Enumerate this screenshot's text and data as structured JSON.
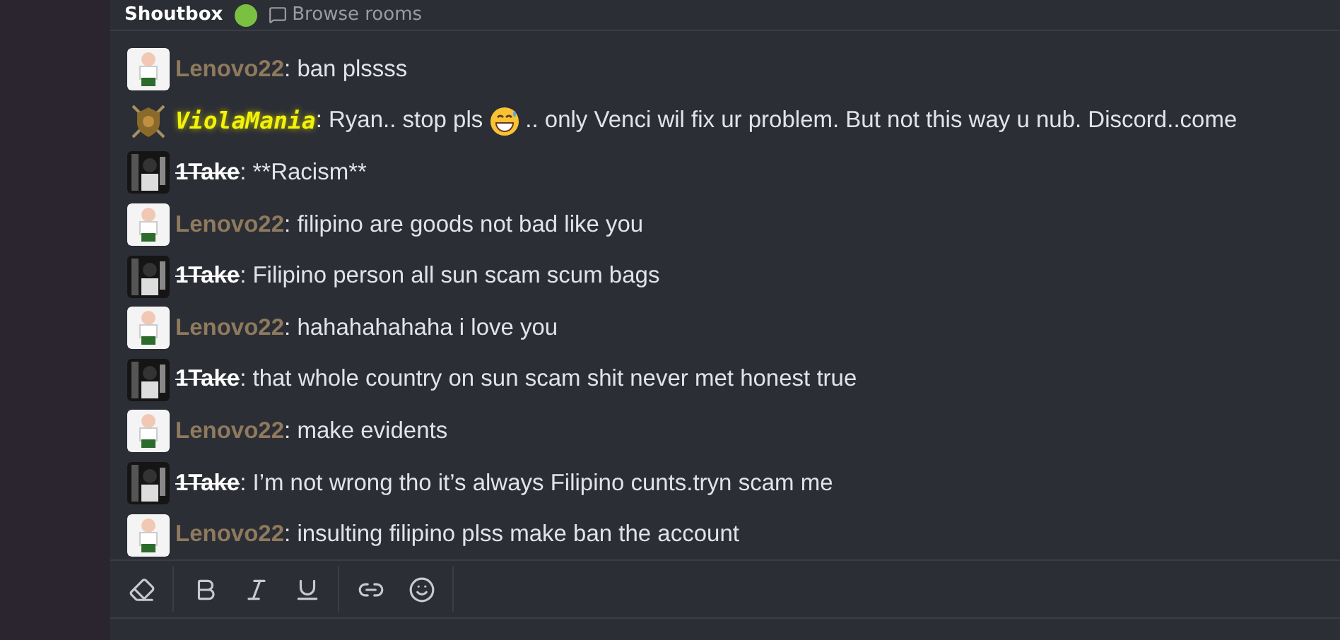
{
  "header": {
    "title": "Shoutbox",
    "link": "Browse rooms"
  },
  "messages": [
    {
      "user": "Lenovo22",
      "kind": "plain",
      "avatar": {
        "kind": "light"
      },
      "parts": [
        {
          "kind": "text",
          "text": ": ban plssss"
        }
      ]
    },
    {
      "user": "ViolaMania",
      "kind": "glow",
      "avatar": {
        "kind": "badge"
      },
      "parts": [
        {
          "kind": "text",
          "text": ": Ryan.. stop pls"
        },
        {
          "kind": "emoji"
        },
        {
          "kind": "text",
          "text": ".. only Venci wil fix ur problem. But not this way u nub. Discord..come"
        }
      ]
    },
    {
      "user": "1Take",
      "kind": "struck",
      "avatar": {
        "kind": "dark"
      },
      "parts": [
        {
          "kind": "text",
          "text": ": **Racism**"
        }
      ]
    },
    {
      "user": "Lenovo22",
      "kind": "plain",
      "avatar": {
        "kind": "light"
      },
      "parts": [
        {
          "kind": "text",
          "text": ": filipino are goods not bad like you"
        }
      ]
    },
    {
      "user": "1Take",
      "kind": "struck",
      "avatar": {
        "kind": "dark"
      },
      "parts": [
        {
          "kind": "text",
          "text": ": Filipino person all sun scam scum bags"
        }
      ]
    },
    {
      "user": "Lenovo22",
      "kind": "plain",
      "avatar": {
        "kind": "light"
      },
      "parts": [
        {
          "kind": "text",
          "text": ": hahahahahaha i love you"
        }
      ]
    },
    {
      "user": "1Take",
      "kind": "struck",
      "avatar": {
        "kind": "dark"
      },
      "parts": [
        {
          "kind": "text",
          "text": ": that whole country on sun scam shit never met honest true"
        }
      ]
    },
    {
      "user": "Lenovo22",
      "kind": "plain",
      "avatar": {
        "kind": "light"
      },
      "parts": [
        {
          "kind": "text",
          "text": ": make evidents"
        }
      ]
    },
    {
      "user": "1Take",
      "kind": "struck",
      "avatar": {
        "kind": "dark"
      },
      "parts": [
        {
          "kind": "text",
          "text": ": I’m not wrong tho it’s always Filipino cunts.tryn scam me"
        }
      ]
    },
    {
      "user": "Lenovo22",
      "kind": "plain",
      "avatar": {
        "kind": "light"
      },
      "parts": [
        {
          "kind": "text",
          "text": ": insulting filipino plss make ban the account"
        }
      ]
    }
  ]
}
